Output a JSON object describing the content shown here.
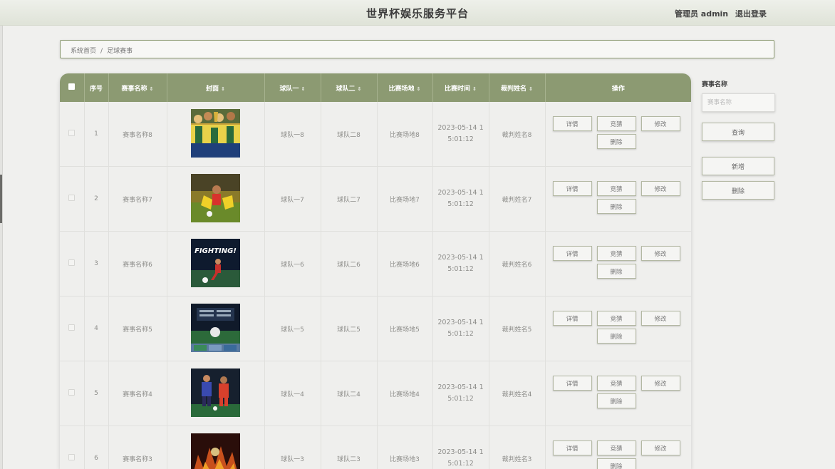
{
  "header": {
    "site_title": "世界杯娱乐服务平台",
    "user_label": "管理员 admin",
    "logout": "退出登录"
  },
  "breadcrumb": {
    "home": "系统首页",
    "separator": "/",
    "current": "足球赛事"
  },
  "table": {
    "columns": {
      "index": "序号",
      "name": "赛事名称",
      "cover": "封面",
      "team1": "球队一",
      "team2": "球队二",
      "venue": "比赛场地",
      "time": "比赛时间",
      "referee": "裁判姓名",
      "ops": "操作"
    },
    "sort_glyph": "⇕",
    "buttons": {
      "detail": "详情",
      "bid": "竞猜",
      "edit": "修改",
      "delete": "删除"
    },
    "rows": [
      {
        "index": "1",
        "name": "赛事名称8",
        "team1": "球队一8",
        "team2": "球队二8",
        "venue": "比赛场地8",
        "time_line1": "2023-05-14 1",
        "time_line2": "5:01:12",
        "referee": "裁判姓名8"
      },
      {
        "index": "2",
        "name": "赛事名称7",
        "team1": "球队一7",
        "team2": "球队二7",
        "venue": "比赛场地7",
        "time_line1": "2023-05-14 1",
        "time_line2": "5:01:12",
        "referee": "裁判姓名7"
      },
      {
        "index": "3",
        "name": "赛事名称6",
        "team1": "球队一6",
        "team2": "球队二6",
        "venue": "比赛场地6",
        "time_line1": "2023-05-14 1",
        "time_line2": "5:01:12",
        "referee": "裁判姓名6",
        "cover_text": "FIGHTING!"
      },
      {
        "index": "4",
        "name": "赛事名称5",
        "team1": "球队一5",
        "team2": "球队二5",
        "venue": "比赛场地5",
        "time_line1": "2023-05-14 1",
        "time_line2": "5:01:12",
        "referee": "裁判姓名5"
      },
      {
        "index": "5",
        "name": "赛事名称4",
        "team1": "球队一4",
        "team2": "球队二4",
        "venue": "比赛场地4",
        "time_line1": "2023-05-14 1",
        "time_line2": "5:01:12",
        "referee": "裁判姓名4"
      },
      {
        "index": "6",
        "name": "赛事名称3",
        "team1": "球队一3",
        "team2": "球队二3",
        "venue": "比赛场地3",
        "time_line1": "2023-05-14 1",
        "time_line2": "5:01:12",
        "referee": "裁判姓名3"
      }
    ]
  },
  "search": {
    "label": "赛事名称",
    "placeholder": "赛事名称",
    "query_button": "查询",
    "add_button": "新增",
    "delete_button": "删除"
  },
  "colors": {
    "accent": "#8c9a72",
    "background": "#f0f0ee"
  }
}
